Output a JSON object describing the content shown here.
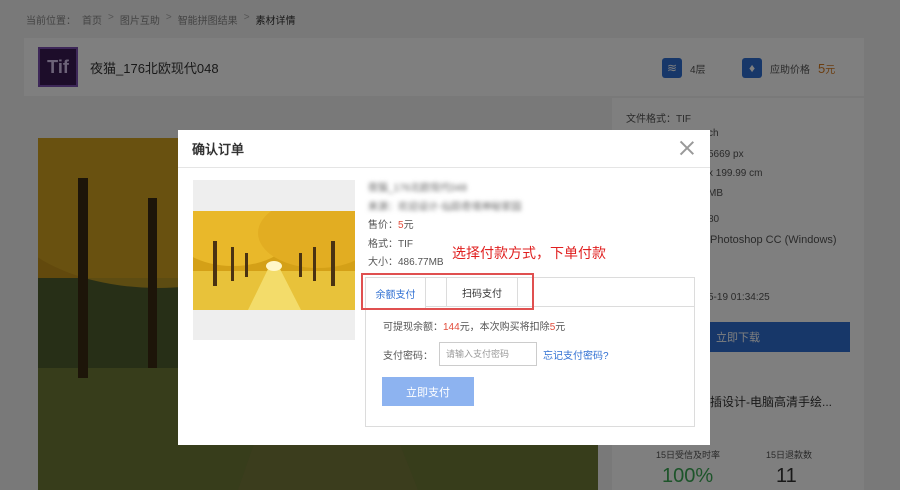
{
  "breadcrumb": [
    "当前位置：",
    "首页",
    "图片互助",
    "智能拼图结果",
    "素材详情"
  ],
  "file": {
    "logo_text": "Tif",
    "title": "夜猫_176北欧现代048"
  },
  "stats": {
    "layers_label": "4层",
    "price_label": "应助价格",
    "price_value": "5",
    "price_unit": "元"
  },
  "side": {
    "lines": [
      "文件格式：TIF",
      "ch",
      "5669 px",
      "x 199.99 cm",
      "MB",
      "80",
      "Photoshop CC (Windows)",
      "5-19 01:34:25"
    ],
    "download_label": "立即下载",
    "related_title": "插设计-电脑高清手绘...",
    "stat1_label": "15日受信及时率",
    "stat1_value": "100%",
    "stat2_label": "15日退款数",
    "stat2_value": "11"
  },
  "modal": {
    "title": "确认订单",
    "item_name": "夜猫_176北欧现代048",
    "item_source": "来源：欢迎设计-仙踪奇境神秘家园",
    "price_label": "售价：",
    "price_value": "5",
    "price_unit": "元",
    "format_label": "格式：TIF",
    "size_label": "大小：486.77MB",
    "annotation": "选择付款方式，下单付款",
    "tabs": [
      "余额支付",
      "扫码支付"
    ],
    "balance_prefix": "可提现余额：",
    "balance_value": "144",
    "balance_mid": "元，本次购买将扣除",
    "deduct_value": "5",
    "deduct_unit": "元",
    "pwd_label": "支付密码：",
    "pwd_placeholder": "请输入支付密码",
    "forgot_label": "忘记支付密码?",
    "pay_label": "立即支付"
  },
  "colors": {
    "accent": "#2f6fd2",
    "price": "#e24c3b",
    "annotation": "#e02020"
  }
}
